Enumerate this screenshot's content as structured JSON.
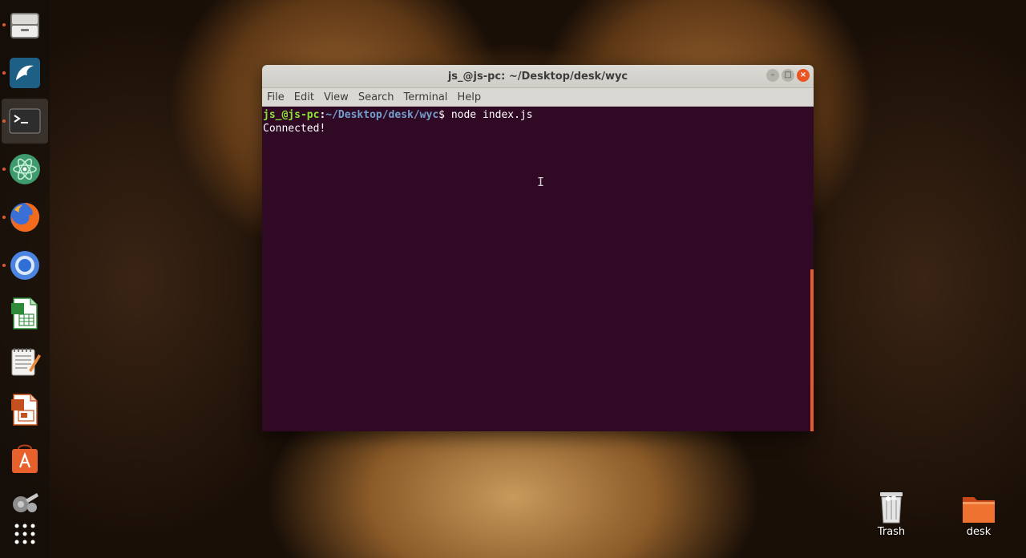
{
  "dock": {
    "items": [
      {
        "name": "files-icon",
        "running": true
      },
      {
        "name": "mysql-workbench-icon",
        "running": true
      },
      {
        "name": "terminal-icon",
        "running": true,
        "active": true
      },
      {
        "name": "atom-icon",
        "running": true
      },
      {
        "name": "firefox-icon",
        "running": true
      },
      {
        "name": "chromium-icon",
        "running": true
      },
      {
        "name": "libreoffice-calc-icon",
        "running": false
      },
      {
        "name": "text-editor-icon",
        "running": false
      },
      {
        "name": "libreoffice-impress-icon",
        "running": false
      },
      {
        "name": "software-center-icon",
        "running": false
      },
      {
        "name": "settings-icon",
        "running": false
      },
      {
        "name": "show-applications-icon",
        "running": false
      }
    ]
  },
  "window": {
    "title": "js_@js-pc: ~/Desktop/desk/wyc",
    "controls": {
      "minimize": "–",
      "maximize": "□",
      "close": "×"
    },
    "menu": [
      "File",
      "Edit",
      "View",
      "Search",
      "Terminal",
      "Help"
    ]
  },
  "terminal": {
    "prompt_user": "js_@js-pc",
    "prompt_sep": ":",
    "prompt_path": "~/Desktop/desk/wyc",
    "prompt_symbol": "$",
    "command": " node index.js",
    "output": "Connected!",
    "cursor_glyph": "I"
  },
  "desktop": {
    "icons": [
      {
        "name": "trash-icon",
        "label": "Trash"
      },
      {
        "name": "desk-folder-icon",
        "label": "desk"
      }
    ]
  },
  "colors": {
    "terminal_bg": "#300a24",
    "prompt_user": "#8ae234",
    "prompt_path": "#729fcf",
    "accent": "#e95420"
  }
}
